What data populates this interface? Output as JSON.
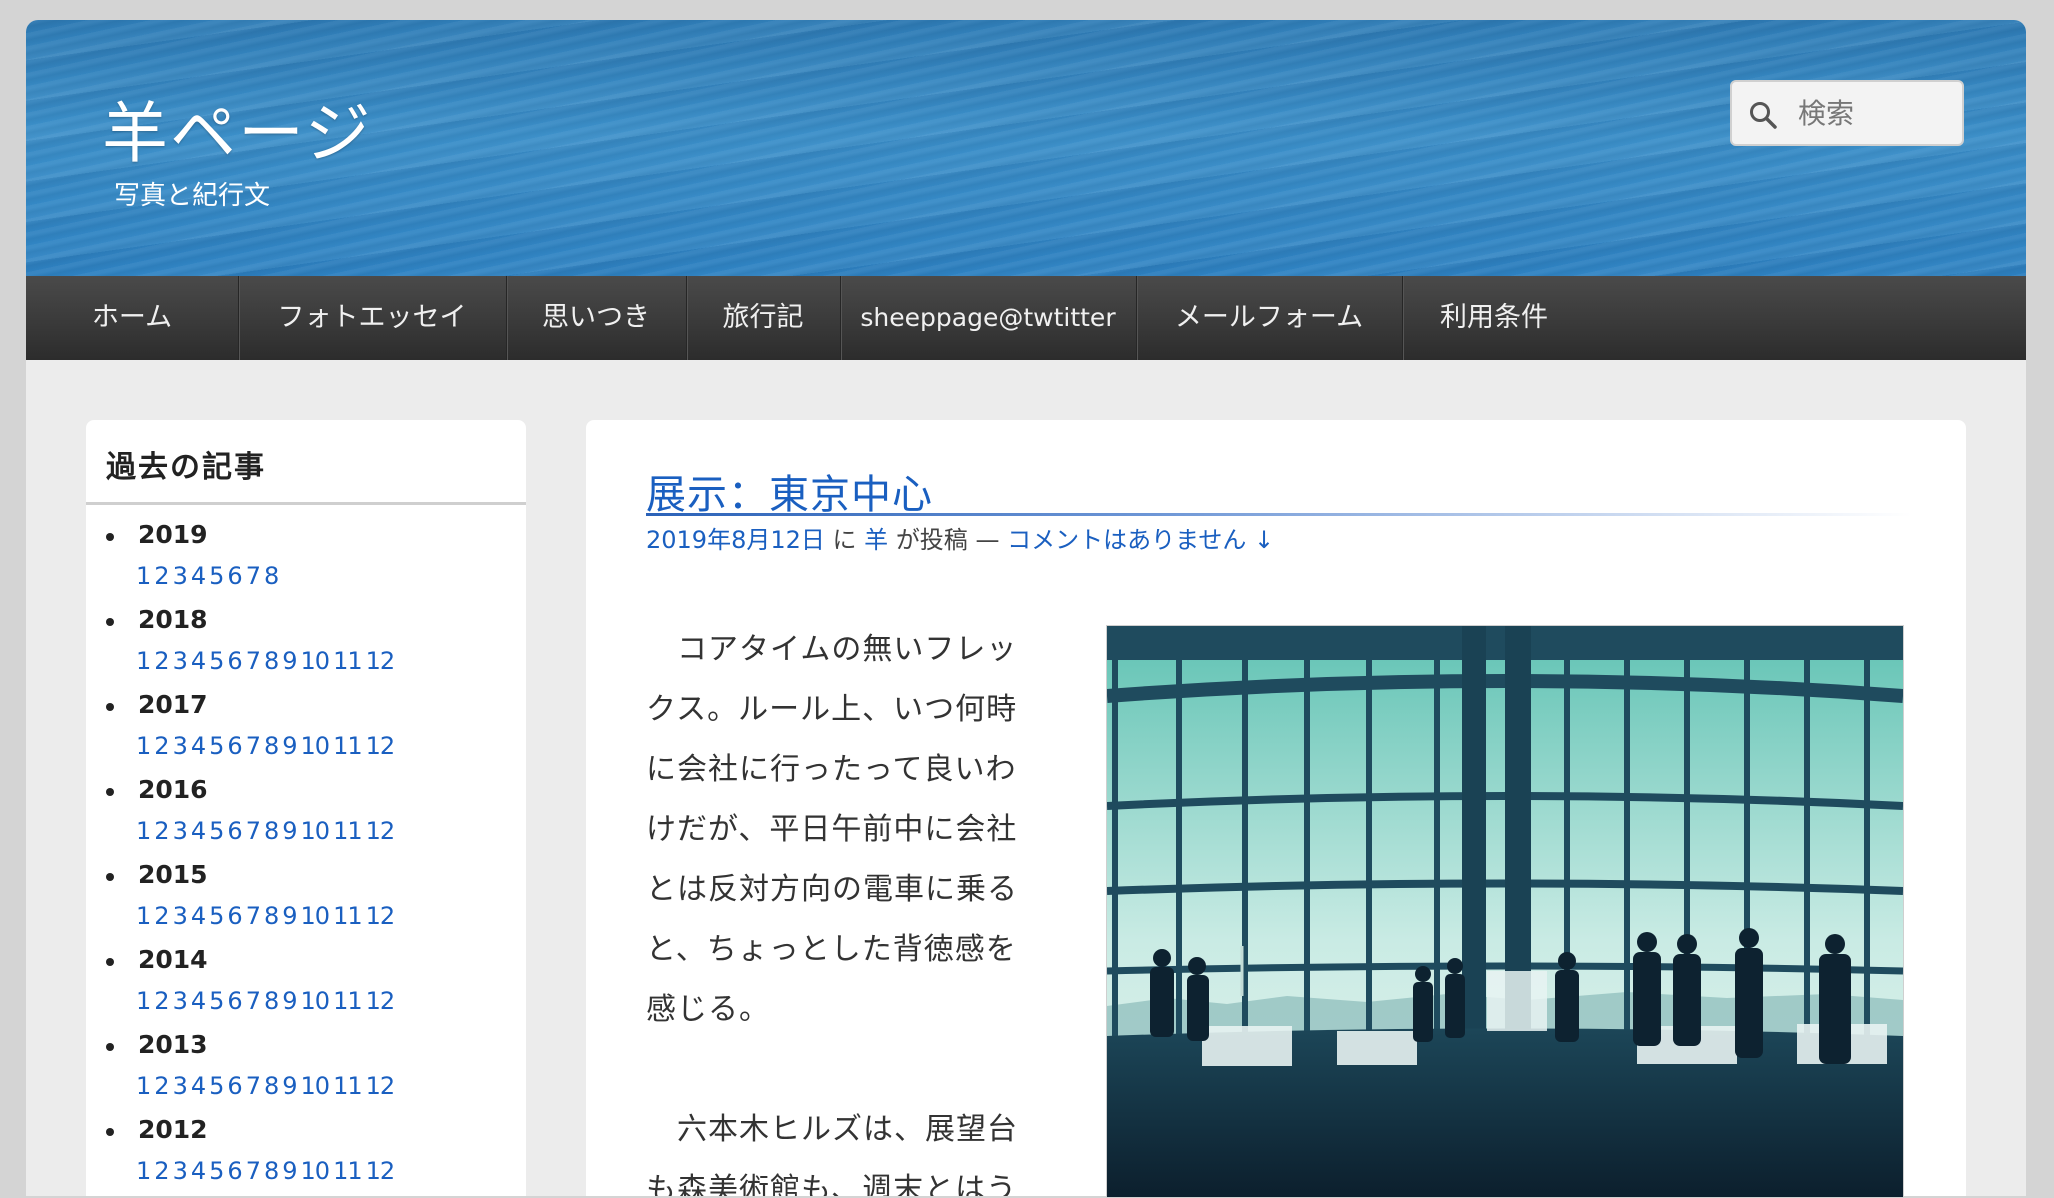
{
  "header": {
    "site_title": "羊ページ",
    "site_description": "写真と紀行文"
  },
  "search": {
    "placeholder": "検索",
    "icon": "search-icon"
  },
  "nav": {
    "items": [
      {
        "label": "ホーム"
      },
      {
        "label": "フォトエッセイ"
      },
      {
        "label": "思いつき"
      },
      {
        "label": "旅行記"
      },
      {
        "label": "sheeppage@twtitter"
      },
      {
        "label": "メールフォーム"
      },
      {
        "label": "利用条件"
      }
    ]
  },
  "sidebar": {
    "title": "過去の記事",
    "years": [
      {
        "year": "2019",
        "months": [
          "1",
          "2",
          "3",
          "4",
          "5",
          "6",
          "7",
          "8"
        ]
      },
      {
        "year": "2018",
        "months": [
          "1",
          "2",
          "3",
          "4",
          "5",
          "6",
          "7",
          "8",
          "9",
          "10",
          "11",
          "12"
        ]
      },
      {
        "year": "2017",
        "months": [
          "1",
          "2",
          "3",
          "4",
          "5",
          "6",
          "7",
          "8",
          "9",
          "10",
          "11",
          "12"
        ]
      },
      {
        "year": "2016",
        "months": [
          "1",
          "2",
          "3",
          "4",
          "5",
          "6",
          "7",
          "8",
          "9",
          "10",
          "11",
          "12"
        ]
      },
      {
        "year": "2015",
        "months": [
          "1",
          "2",
          "3",
          "4",
          "5",
          "6",
          "7",
          "8",
          "9",
          "10",
          "11",
          "12"
        ]
      },
      {
        "year": "2014",
        "months": [
          "1",
          "2",
          "3",
          "4",
          "5",
          "6",
          "7",
          "8",
          "9",
          "10",
          "11",
          "12"
        ]
      },
      {
        "year": "2013",
        "months": [
          "1",
          "2",
          "3",
          "4",
          "5",
          "6",
          "7",
          "8",
          "9",
          "10",
          "11",
          "12"
        ]
      },
      {
        "year": "2012",
        "months": [
          "1",
          "2",
          "3",
          "4",
          "5",
          "6",
          "7",
          "8",
          "9",
          "10",
          "11",
          "12"
        ]
      }
    ]
  },
  "post": {
    "title": "展示：東京中心",
    "meta": {
      "date": "2019年8月12日",
      "by": "に",
      "author": "羊",
      "posted": "が投稿 —",
      "comments": "コメントはありません ↓"
    },
    "paragraphs": [
      [
        "　コアタイムの無いフレッ",
        "クス。ルール上、いつ何時",
        "に会社に行ったって良いわ",
        "けだが、平日午前中に会社",
        "とは反対方向の電車に乗る",
        "と、ちょっとした背徳感を",
        "感じる。"
      ],
      [
        "　六本木ヒルズは、展望台",
        "も森美術館も、週末とはう"
      ]
    ]
  },
  "colors": {
    "link": "#1a5fc0",
    "header_blue": "#3b8fc9",
    "nav_dark": "#3a3a3a"
  }
}
